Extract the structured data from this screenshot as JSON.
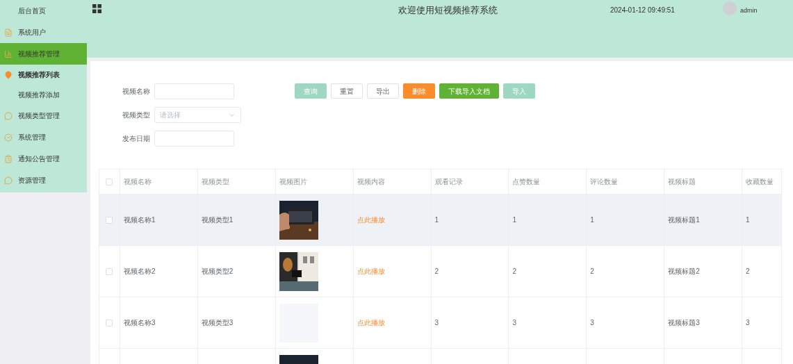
{
  "sidebar": {
    "items": [
      {
        "label": "后台首页",
        "selected": false
      },
      {
        "label": "系统用户",
        "selected": false
      },
      {
        "label": "视频推荐管理",
        "selected": true,
        "children": [
          {
            "label": "视频推荐列表",
            "selected": true
          },
          {
            "label": "视频推荐添加",
            "selected": false
          }
        ]
      },
      {
        "label": "视频类型管理",
        "selected": false
      },
      {
        "label": "系统管理",
        "selected": false
      },
      {
        "label": "通知公告管理",
        "selected": false
      },
      {
        "label": "资源管理",
        "selected": false
      }
    ]
  },
  "header": {
    "title": "欢迎使用短视频推荐系统",
    "datetime": "2024-01-12 09:49:51",
    "user": "admin"
  },
  "filters": [
    {
      "label": "视频名称",
      "kind": "text"
    },
    {
      "label": "视频类型",
      "kind": "select",
      "placeholder": "请选择"
    },
    {
      "label": "发布日期",
      "kind": "text"
    }
  ],
  "buttons": [
    {
      "label": "查询",
      "kind": "teal"
    },
    {
      "label": "重置",
      "kind": "plain"
    },
    {
      "label": "导出",
      "kind": "plain"
    },
    {
      "label": "删除",
      "kind": "orange"
    },
    {
      "label": "下载导入文档",
      "kind": "green"
    },
    {
      "label": "导入",
      "kind": "teal"
    }
  ],
  "table": {
    "all_checked": false,
    "columns": [
      "视频名称",
      "视频类型",
      "视频图片",
      "视频内容",
      "观看记录",
      "点赞数量",
      "评论数量",
      "视频标题",
      "收藏数量"
    ],
    "rows": [
      {
        "checked": false,
        "hovered": true,
        "name": "视频名称1",
        "type": "视频类型1",
        "content": "点此播放",
        "views": "1",
        "likes": "1",
        "comments": "1",
        "title": "视频标题1",
        "favorites": "1"
      },
      {
        "checked": false,
        "hovered": false,
        "name": "视频名称2",
        "type": "视频类型2",
        "content": "点此播放",
        "views": "2",
        "likes": "2",
        "comments": "2",
        "title": "视频标题2",
        "favorites": "2"
      },
      {
        "checked": false,
        "hovered": false,
        "name": "视频名称3",
        "type": "视频类型3",
        "image": {
          "kind": "empty"
        },
        "content": "点此播放",
        "views": "3",
        "likes": "3",
        "comments": "3",
        "title": "视频标题3",
        "favorites": "3"
      },
      {
        "hovered": false
      }
    ]
  }
}
